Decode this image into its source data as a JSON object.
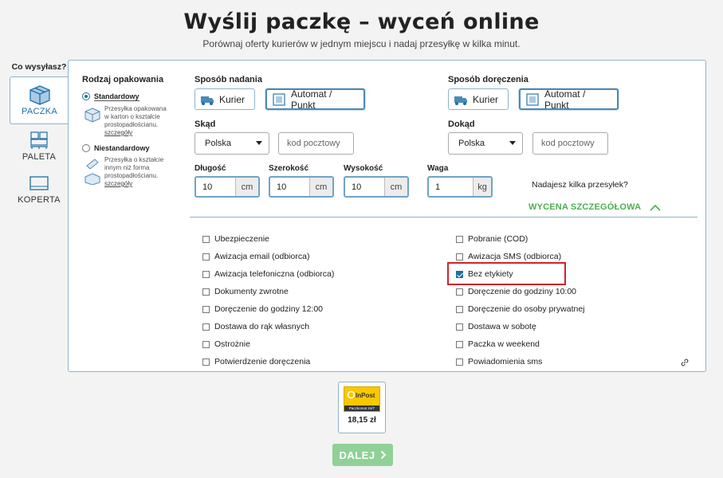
{
  "header": {
    "title": "Wyślij paczkę – wyceń online",
    "subtitle": "Porównaj oferty kurierów w jednym miejscu i nadaj przesyłkę w kilka minut."
  },
  "left_tabs": {
    "heading": "Co wysyłasz?",
    "items": [
      {
        "label": "PACZKA",
        "icon": "parcel-icon",
        "active": true
      },
      {
        "label": "PALETA",
        "icon": "pallet-icon",
        "active": false
      },
      {
        "label": "KOPERTA",
        "icon": "envelope-icon",
        "active": false
      }
    ]
  },
  "packaging": {
    "title": "Rodzaj opakowania",
    "options": [
      {
        "label": "Standardowy",
        "selected": true,
        "desc": [
          "Przesyłka opakowana",
          "w karton o kształcie",
          "prostopadłościanu."
        ],
        "link": "szczegóły"
      },
      {
        "label": "Niestandardowy",
        "selected": false,
        "desc": [
          "Przesyłka o kształcie",
          "innym niż forma",
          "prostopadłościanu."
        ],
        "link": "szczegóły"
      }
    ]
  },
  "shipping": {
    "send_title": "Sposób nadania",
    "delivery_title": "Sposób doręczenia",
    "courier_label": "Kurier",
    "locker_label": "Automat / Punkt"
  },
  "from": {
    "label": "Skąd",
    "country": "Polska",
    "postal_placeholder": "kod pocztowy"
  },
  "to": {
    "label": "Dokąd",
    "country": "Polska",
    "postal_placeholder": "kod pocztowy"
  },
  "dimensions": [
    {
      "label": "Długość",
      "value": "10",
      "unit": "cm"
    },
    {
      "label": "Szerokość",
      "value": "10",
      "unit": "cm"
    },
    {
      "label": "Wysokość",
      "value": "10",
      "unit": "cm"
    },
    {
      "label": "Waga",
      "value": "1",
      "unit": "kg"
    }
  ],
  "multi_link": "Nadajesz kilka przesyłek?",
  "detail_toggle": "WYCENA SZCZEGÓŁOWA",
  "options_left": [
    {
      "label": "Ubezpieczenie",
      "checked": false
    },
    {
      "label": "Awizacja email (odbiorca)",
      "checked": false
    },
    {
      "label": "Awizacja telefoniczna (odbiorca)",
      "checked": false
    },
    {
      "label": "Dokumenty zwrotne",
      "checked": false
    },
    {
      "label": "Doręczenie do godziny 12:00",
      "checked": false
    },
    {
      "label": "Dostawa do rąk własnych",
      "checked": false
    },
    {
      "label": "Ostrożnie",
      "checked": false
    },
    {
      "label": "Potwierdzenie doręczenia",
      "checked": false
    }
  ],
  "options_right": [
    {
      "label": "Pobranie (COD)",
      "checked": false
    },
    {
      "label": "Awizacja SMS (odbiorca)",
      "checked": false
    },
    {
      "label": "Bez etykiety",
      "checked": true
    },
    {
      "label": "Doręczenie do godziny 10:00",
      "checked": false
    },
    {
      "label": "Doręczenie do osoby prywatnej",
      "checked": false
    },
    {
      "label": "Dostawa w sobotę",
      "checked": false
    },
    {
      "label": "Paczka w weekend",
      "checked": false
    },
    {
      "label": "Powiadomienia sms",
      "checked": false
    }
  ],
  "offer": {
    "brand": "InPost",
    "brand_sub": "Paczkomat 24/7",
    "price": "18,15 zł"
  },
  "next_button": "DALEJ",
  "colors": {
    "accent": "#1f6fa3",
    "green": "#4caf50",
    "highlight": "#d0232a",
    "inpost_yellow": "#f9c800"
  }
}
